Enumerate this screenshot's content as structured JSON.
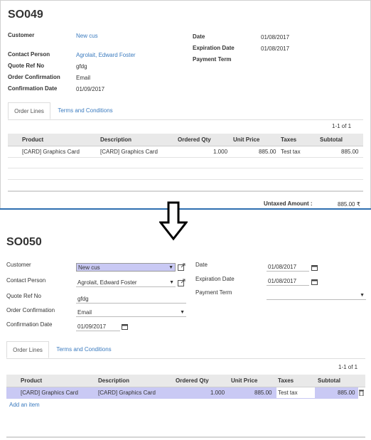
{
  "top_form": {
    "title": "SO049",
    "fields_left": [
      {
        "label": "Customer",
        "value": "New cus"
      },
      {
        "label": "Contact Person",
        "value": "Agrolait, Edward Foster"
      },
      {
        "label": "Quote Ref No",
        "value": "gfdg"
      },
      {
        "label": "Order Confirmation",
        "value": "Email"
      },
      {
        "label": "Confirmation Date",
        "value": "01/09/2017"
      }
    ],
    "fields_right": [
      {
        "label": "Date",
        "value": "01/08/2017"
      },
      {
        "label": "Expiration Date",
        "value": "01/08/2017"
      },
      {
        "label": "Payment Term",
        "value": ""
      }
    ],
    "tabs": [
      "Order Lines",
      "Terms and Conditions"
    ],
    "pager": "1-1 of 1",
    "columns": [
      "Product",
      "Description",
      "Ordered Qty",
      "Unit Price",
      "Taxes",
      "Subtotal"
    ],
    "rows": [
      {
        "product": "[CARD] Graphics Card",
        "description": "[CARD] Graphics Card",
        "qty": "1.000",
        "unit_price": "885.00",
        "taxes": "Test tax",
        "subtotal": "885.00"
      }
    ],
    "untaxed_label": "Untaxed Amount :",
    "untaxed_value": "885.00 ₹"
  },
  "bottom_form": {
    "title": "SO050",
    "fields_left": [
      {
        "label": "Customer",
        "value": "New cus"
      },
      {
        "label": "Contact Person",
        "value": "Agrolait, Edward Foster"
      },
      {
        "label": "Quote Ref No",
        "value": "gfdg"
      },
      {
        "label": "Order Confirmation",
        "value": "Email"
      },
      {
        "label": "Confirmation Date",
        "value": "01/09/2017"
      }
    ],
    "fields_right": [
      {
        "label": "Date",
        "value": "01/08/2017"
      },
      {
        "label": "Expiration Date",
        "value": "01/08/2017"
      },
      {
        "label": "Payment Term",
        "value": ""
      }
    ],
    "tabs": [
      "Order Lines",
      "Terms and Conditions"
    ],
    "pager": "1-1 of 1",
    "columns": [
      "Product",
      "Description",
      "Ordered Qty",
      "Unit Price",
      "Taxes",
      "Subtotal"
    ],
    "rows": [
      {
        "product": "[CARD] Graphics Card",
        "description": "[CARD] Graphics Card",
        "qty": "1.000",
        "unit_price": "885.00",
        "taxes": "Test tax",
        "subtotal": "885.00"
      }
    ],
    "add_item": "Add an item"
  },
  "icons": {
    "arrow": "down-arrow-icon",
    "external": "external-link-icon",
    "calendar": "calendar-icon",
    "trash": "trash-icon"
  },
  "colors": {
    "link": "#3b7bbf",
    "divider": "#2e6fb0",
    "selected_row": "#c9c9f4",
    "header_bg": "#e9e9e9"
  }
}
